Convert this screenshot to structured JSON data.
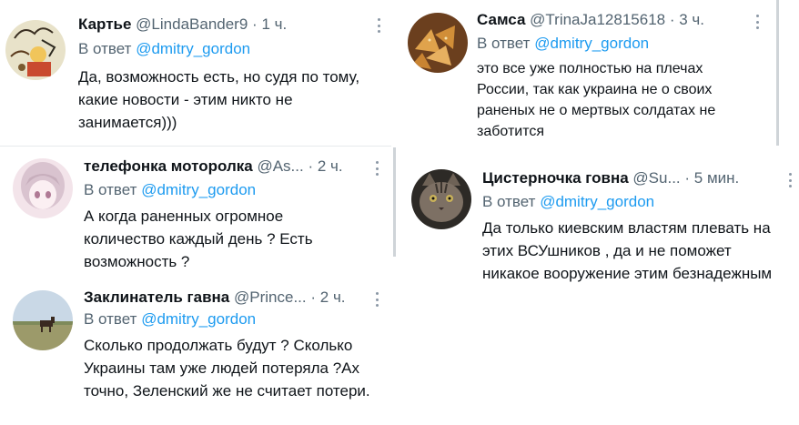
{
  "tweets": [
    {
      "name": "Картье",
      "handle": "@LindaBander9",
      "dot": "·",
      "time": "1 ч.",
      "reply_prefix": "В ответ",
      "mention": "@dmitry_gordon",
      "text": "Да, возможность есть, но судя по тому, какие новости - этим никто не занимается)))",
      "avatar_icon": "artwork-avatar"
    },
    {
      "name": "телефонка моторолка",
      "handle": "@As...",
      "dot": "·",
      "time": "2 ч.",
      "reply_prefix": "В ответ",
      "mention": "@dmitry_gordon",
      "text": "А когда раненных огромное количество каждый день ? Есть возможность ?",
      "avatar_icon": "anime-girl-avatar"
    },
    {
      "name": "Заклинатель гавна",
      "handle": "@Prince...",
      "dot": "·",
      "time": "2 ч.",
      "reply_prefix": "В ответ",
      "mention": "@dmitry_gordon",
      "text": "Сколько продолжать будут ? Сколько Украины там уже людей потеряла ?Ах точно, Зеленский же не считает потери.",
      "avatar_icon": "horse-field-avatar"
    },
    {
      "name": "Самса",
      "handle": "@TrinaJa12815618",
      "dot": "·",
      "time": "3 ч.",
      "reply_prefix": "В ответ",
      "mention": "@dmitry_gordon",
      "text": "это все уже полностью на плечах России, так как украина не о своих раненых не о мертвых солдатах не заботится",
      "avatar_icon": "pastry-avatar"
    },
    {
      "name": "Цистерночка говна",
      "handle": "@Su...",
      "dot": "·",
      "time": "5 мин.",
      "reply_prefix": "В ответ",
      "mention": "@dmitry_gordon",
      "text": "Да только киевским властям плевать на этих ВСУшников , да и не поможет никакое вооружение этим безнадежным",
      "avatar_icon": "cat-avatar"
    }
  ],
  "colors": {
    "name": "#0f1419",
    "secondary": "#536471",
    "mention": "#1d9bf0",
    "divider": "#e6e9ec"
  }
}
